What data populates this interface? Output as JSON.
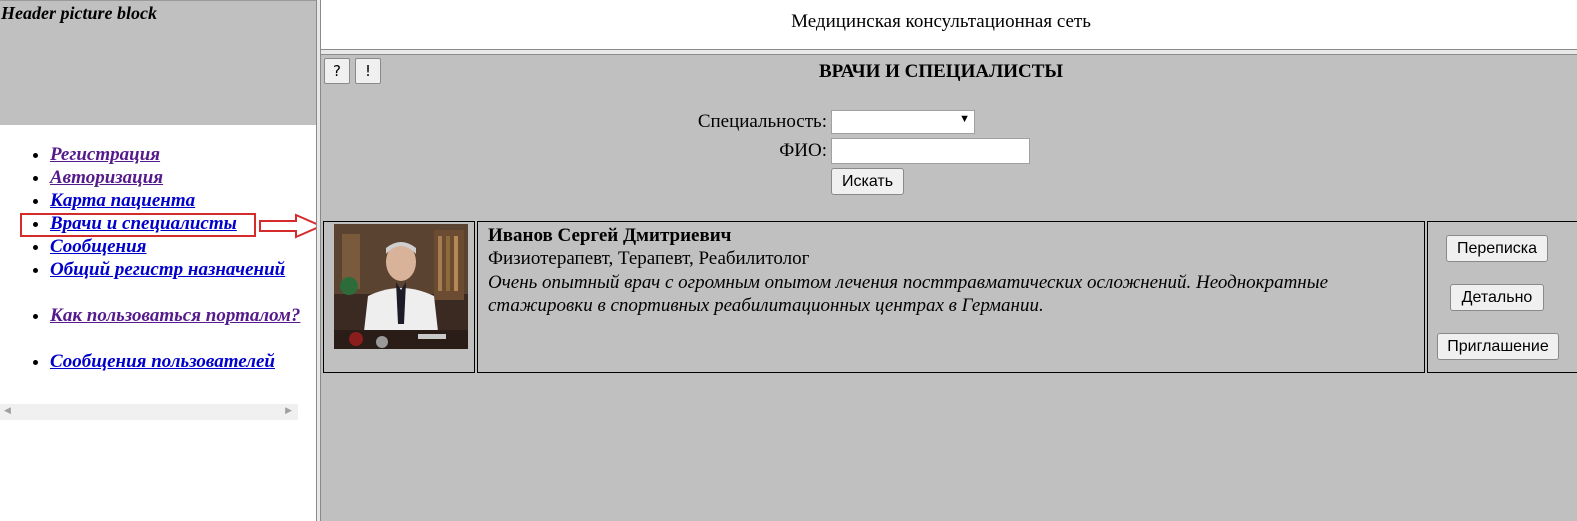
{
  "left": {
    "header_text": "Header picture block",
    "nav": [
      {
        "label": "Регистрация"
      },
      {
        "label": "Авторизация"
      },
      {
        "label": "Карта пациента"
      },
      {
        "label": "Врачи и специалисты"
      },
      {
        "label": "Сообщения"
      },
      {
        "label": "Общий регистр назначений"
      },
      {
        "label": "Как пользоваться порталом?"
      },
      {
        "label": "Сообщения пользователей"
      }
    ]
  },
  "top": {
    "site_title": "Медицинская консультационная сеть"
  },
  "main": {
    "help_button": "?",
    "info_button": "!",
    "heading": "ВРАЧИ И СПЕЦИАЛИСТЫ",
    "specialty_label": "Специальность:",
    "specialty_value": "",
    "fio_label": "ФИО:",
    "fio_value": "",
    "search_button": "Искать",
    "doctor": {
      "name": "Иванов Сергей Дмитриевич",
      "specialties": "Физиотерапевт, Терапевт, Реабилитолог",
      "description": "Очень опытный врач с огромным опытом лечения посттравматических осложнений. Неоднократные стажировки в спортивных реабилитационных центрах в Германии."
    },
    "actions": {
      "correspondence": "Переписка",
      "details": "Детально",
      "invitation": "Приглашение"
    }
  },
  "colors": {
    "panel_gray": "#c0c0c0",
    "highlight_red": "#d62b2b",
    "link_blue": "#0000cc",
    "link_visited": "#551a8b"
  }
}
